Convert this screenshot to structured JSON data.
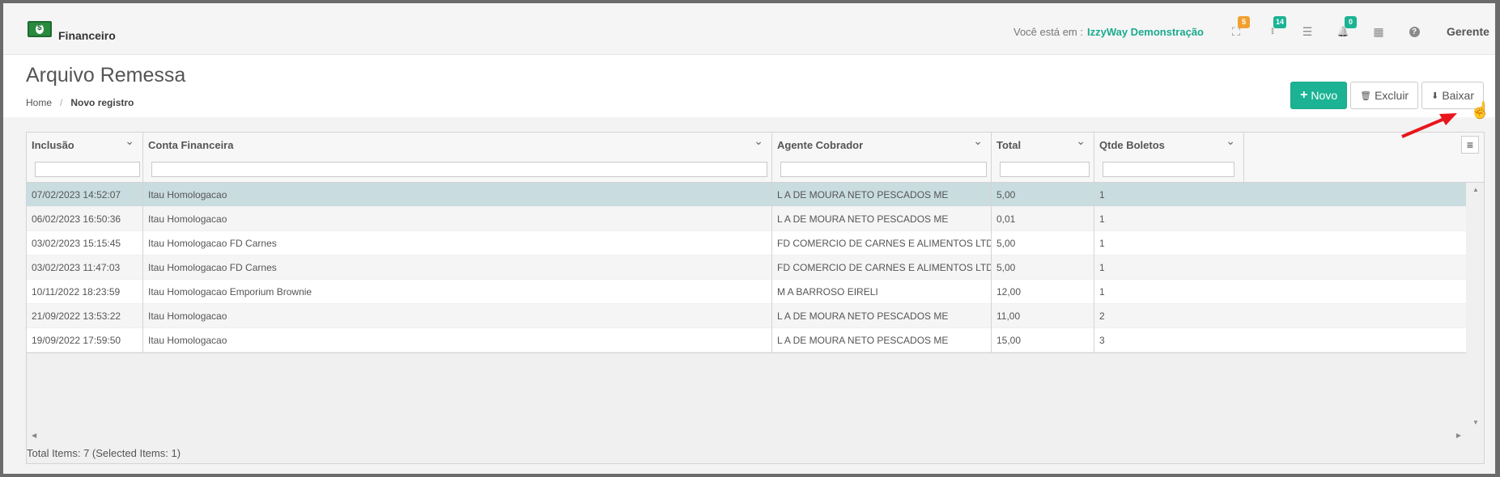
{
  "app": {
    "module_label": "Financeiro",
    "context_prefix": "Você está em :",
    "context_company": "IzzyWay Demonstração",
    "user_name": "Gerente",
    "icons": [
      {
        "name": "sitemap-icon",
        "glyph": "⛶",
        "badge": "5",
        "badge_color": "#f0a030"
      },
      {
        "name": "grid-icon",
        "glyph": "⁞⁞⁞",
        "badge": "14",
        "badge_color": "#1bb394"
      },
      {
        "name": "list-icon",
        "glyph": "☰",
        "badge": "",
        "badge_color": ""
      },
      {
        "name": "bell-icon",
        "glyph": "🔔",
        "badge": "0",
        "badge_color": "#1bb394"
      },
      {
        "name": "calendar-icon",
        "glyph": "▦",
        "badge": "",
        "badge_color": ""
      },
      {
        "name": "help-icon",
        "glyph": "?",
        "badge": "",
        "badge_color": ""
      }
    ]
  },
  "page": {
    "title": "Arquivo Remessa",
    "breadcrumb": {
      "home": "Home",
      "current": "Novo registro"
    }
  },
  "actions": {
    "novo_icon": "+",
    "novo_label": "Novo",
    "excluir_icon": "🗑",
    "excluir_label": "Excluir",
    "baixar_icon": "⬇",
    "baixar_label": "Baixar"
  },
  "grid": {
    "columns": [
      {
        "key": "inclusao",
        "label": "Inclusão"
      },
      {
        "key": "conta",
        "label": "Conta Financeira"
      },
      {
        "key": "agente",
        "label": "Agente Cobrador"
      },
      {
        "key": "total",
        "label": "Total"
      },
      {
        "key": "qtde",
        "label": "Qtde Boletos"
      }
    ],
    "rows": [
      {
        "inclusao": "07/02/2023 14:52:07",
        "conta": "Itau Homologacao",
        "agente": "L A DE MOURA NETO PESCADOS ME",
        "total": "5,00",
        "qtde": "1",
        "selected": true
      },
      {
        "inclusao": "06/02/2023 16:50:36",
        "conta": "Itau Homologacao",
        "agente": "L A DE MOURA NETO PESCADOS ME",
        "total": "0,01",
        "qtde": "1",
        "selected": false
      },
      {
        "inclusao": "03/02/2023 15:15:45",
        "conta": "Itau Homologacao FD Carnes",
        "agente": "FD COMERCIO DE CARNES E ALIMENTOS LTDA",
        "total": "5,00",
        "qtde": "1",
        "selected": false
      },
      {
        "inclusao": "03/02/2023 11:47:03",
        "conta": "Itau Homologacao FD Carnes",
        "agente": "FD COMERCIO DE CARNES E ALIMENTOS LTDA",
        "total": "5,00",
        "qtde": "1",
        "selected": false
      },
      {
        "inclusao": "10/11/2022 18:23:59",
        "conta": "Itau Homologacao Emporium Brownie",
        "agente": "M A BARROSO EIRELI",
        "total": "12,00",
        "qtde": "1",
        "selected": false
      },
      {
        "inclusao": "21/09/2022 13:53:22",
        "conta": "Itau Homologacao",
        "agente": "L A DE MOURA NETO PESCADOS ME",
        "total": "11,00",
        "qtde": "2",
        "selected": false
      },
      {
        "inclusao": "19/09/2022 17:59:50",
        "conta": "Itau Homologacao",
        "agente": "L A DE MOURA NETO PESCADOS ME",
        "total": "15,00",
        "qtde": "3",
        "selected": false
      }
    ],
    "footer": "Total Items: 7 (Selected Items: 1)"
  },
  "colors": {
    "accent": "#1bb394",
    "selected_row": "#c9dde0",
    "annotation_arrow": "#e8161b"
  }
}
